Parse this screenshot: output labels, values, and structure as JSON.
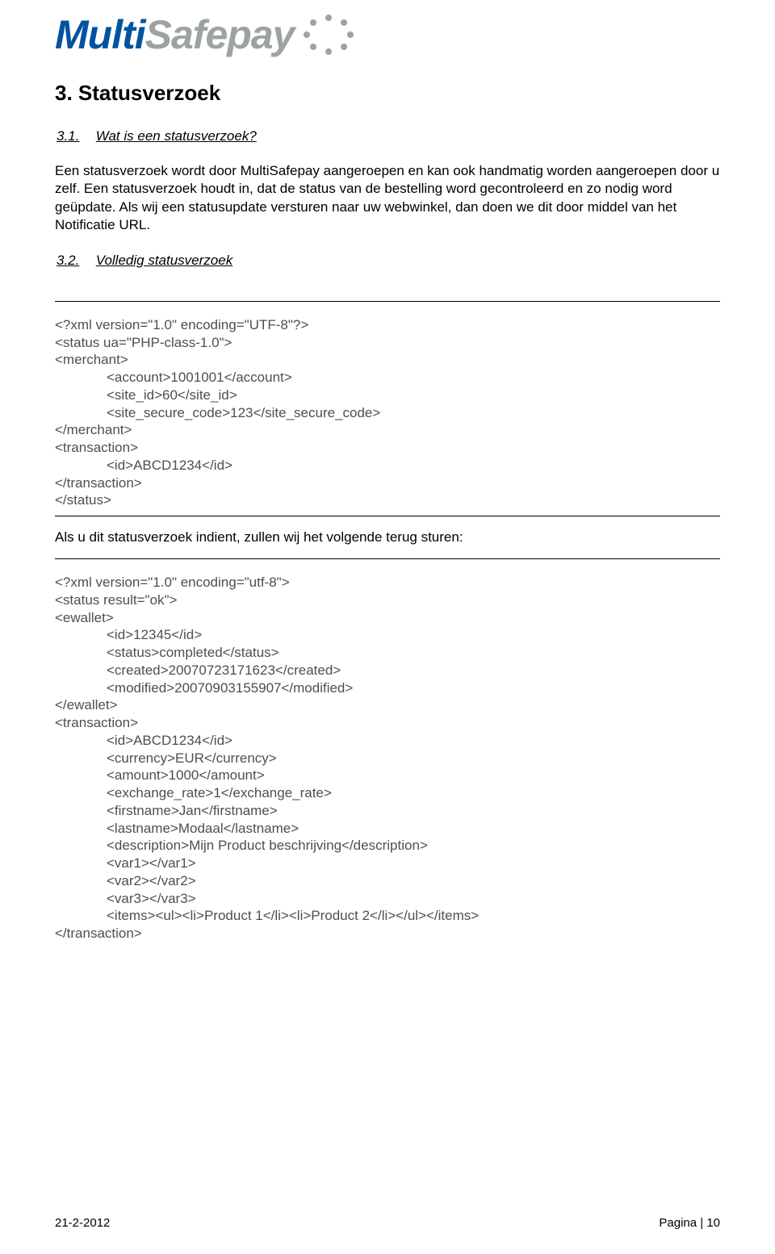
{
  "logo": {
    "part1": "Multi",
    "part2": "Safepay"
  },
  "heading": "3. Statusverzoek",
  "sub1": {
    "num": "3.1.",
    "title": "Wat is een statusverzoek?"
  },
  "para1": "Een statusverzoek wordt door MultiSafepay aangeroepen en kan ook handmatig worden aangeroepen door u zelf. Een statusverzoek houdt in, dat de status van de bestelling word gecontroleerd en zo nodig word geüpdate. Als wij een statusupdate versturen naar uw webwinkel, dan doen we dit door middel van het Notificatie URL.",
  "sub2": {
    "num": "3.2.",
    "title": "Volledig statusverzoek"
  },
  "xml1": {
    "lines": [
      "<?xml version=\"1.0\" encoding=\"UTF-8\"?>",
      "<status ua=\"PHP-class-1.0\">",
      "<merchant>",
      "        <account>1001001</account>",
      "        <site_id>60</site_id>",
      "        <site_secure_code>123</site_secure_code>",
      "</merchant>",
      "<transaction>",
      "        <id>ABCD1234</id>",
      "</transaction>",
      "</status>"
    ]
  },
  "between": "Als u dit statusverzoek indient, zullen wij het volgende terug sturen:",
  "xml2": {
    "lines": [
      "<?xml version=\"1.0\" encoding=\"utf-8\">",
      "<status result=\"ok\">",
      "<ewallet>",
      "        <id>12345</id>",
      "        <status>completed</status>",
      "        <created>20070723171623</created>",
      "        <modified>20070903155907</modified>",
      "</ewallet>",
      "<transaction>",
      "        <id>ABCD1234</id>",
      "        <currency>EUR</currency>",
      "        <amount>1000</amount>",
      "        <exchange_rate>1</exchange_rate>",
      "        <firstname>Jan</firstname>",
      "        <lastname>Modaal</lastname>",
      "        <description>Mijn Product beschrijving</description>",
      "        <var1></var1>",
      "        <var2></var2>",
      "        <var3></var3>",
      "        <items><ul><li>Product 1</li><li>Product 2</li></ul></items>",
      "</transaction>"
    ]
  },
  "footer": {
    "date": "21-2-2012",
    "page": "Pagina | 10"
  }
}
